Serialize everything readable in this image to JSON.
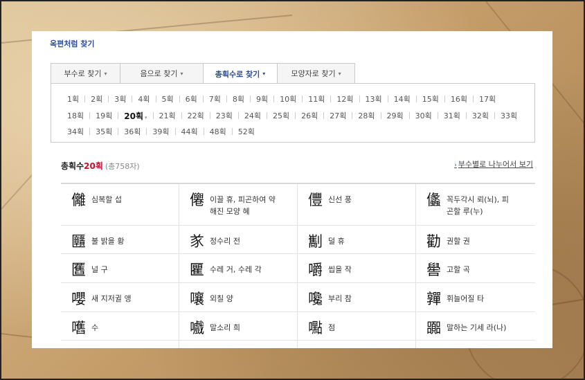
{
  "panel_title": "옥편처럼 찾기",
  "tabs": [
    {
      "label": "부수로 찾기",
      "active": false
    },
    {
      "label": "음으로 찾기",
      "active": false
    },
    {
      "label": "총획수로 찾기",
      "active": true
    },
    {
      "label": "모양자로 찾기",
      "active": false
    }
  ],
  "stroke_rows": [
    [
      "1획",
      "2획",
      "3획",
      "4획",
      "5획",
      "6획",
      "7획",
      "8획",
      "9획",
      "10획",
      "11획",
      "12획",
      "13획",
      "14획",
      "15획",
      "16획",
      "17획"
    ],
    [
      "18획",
      "19획",
      "20획",
      "21획",
      "22획",
      "23획",
      "24획",
      "25획",
      "26획",
      "27획",
      "28획",
      "29획",
      "30획",
      "31획",
      "32획",
      "33획"
    ],
    [
      "34획",
      "35획",
      "36획",
      "39획",
      "44획",
      "48획",
      "52획"
    ]
  ],
  "selected_stroke": "20획",
  "result": {
    "prefix": "총획수",
    "count_label": "20획",
    "total": "(총758자)"
  },
  "radical_link": "부수별로 나누어서 보기",
  "characters": [
    [
      {
        "hanja": "㒧",
        "meaning": "심복할 섭"
      },
      {
        "hanja": "㒨",
        "meaning": "이끌 휴, 피곤하여 약\n해진 모양 혜"
      },
      {
        "hanja": "㒥",
        "meaning": "신선 풍"
      },
      {
        "hanja": "㒩",
        "meaning": "꼭두각시 뢰(뇌), 피\n곤할 루(누)"
      }
    ],
    [
      {
        "hanja": "㔶",
        "meaning": "불 밝을 황"
      },
      {
        "hanja": "㒸",
        "meaning": "정수리 전"
      },
      {
        "hanja": "㔒",
        "meaning": "덜 휴"
      },
      {
        "hanja": "勸",
        "meaning": "권할 권"
      }
    ],
    [
      {
        "hanja": "匶",
        "meaning": "널 구"
      },
      {
        "hanja": "匷",
        "meaning": "수레 거, 수레 각"
      },
      {
        "hanja": "嚼",
        "meaning": "씹을 작"
      },
      {
        "hanja": "嚳",
        "meaning": "고할 곡"
      }
    ],
    [
      {
        "hanja": "嚶",
        "meaning": "새 지저귈 앵"
      },
      {
        "hanja": "嚷",
        "meaning": "외칠 양"
      },
      {
        "hanja": "嚵",
        "meaning": "부리 참"
      },
      {
        "hanja": "嚲",
        "meaning": "휘늘어질 타"
      }
    ],
    [
      {
        "hanja": "嚿",
        "meaning": "수"
      },
      {
        "hanja": "嚱",
        "meaning": "말소리 희"
      },
      {
        "hanja": "嚸",
        "meaning": "점"
      },
      {
        "hanja": "嚻",
        "meaning": "말하는 기세 라(나)"
      }
    ],
    [
      {
        "hanja": "",
        "meaning": ""
      },
      {
        "hanja": "",
        "meaning": ""
      },
      {
        "hanja": "",
        "meaning": ""
      },
      {
        "hanja": "",
        "meaning": ""
      }
    ]
  ]
}
